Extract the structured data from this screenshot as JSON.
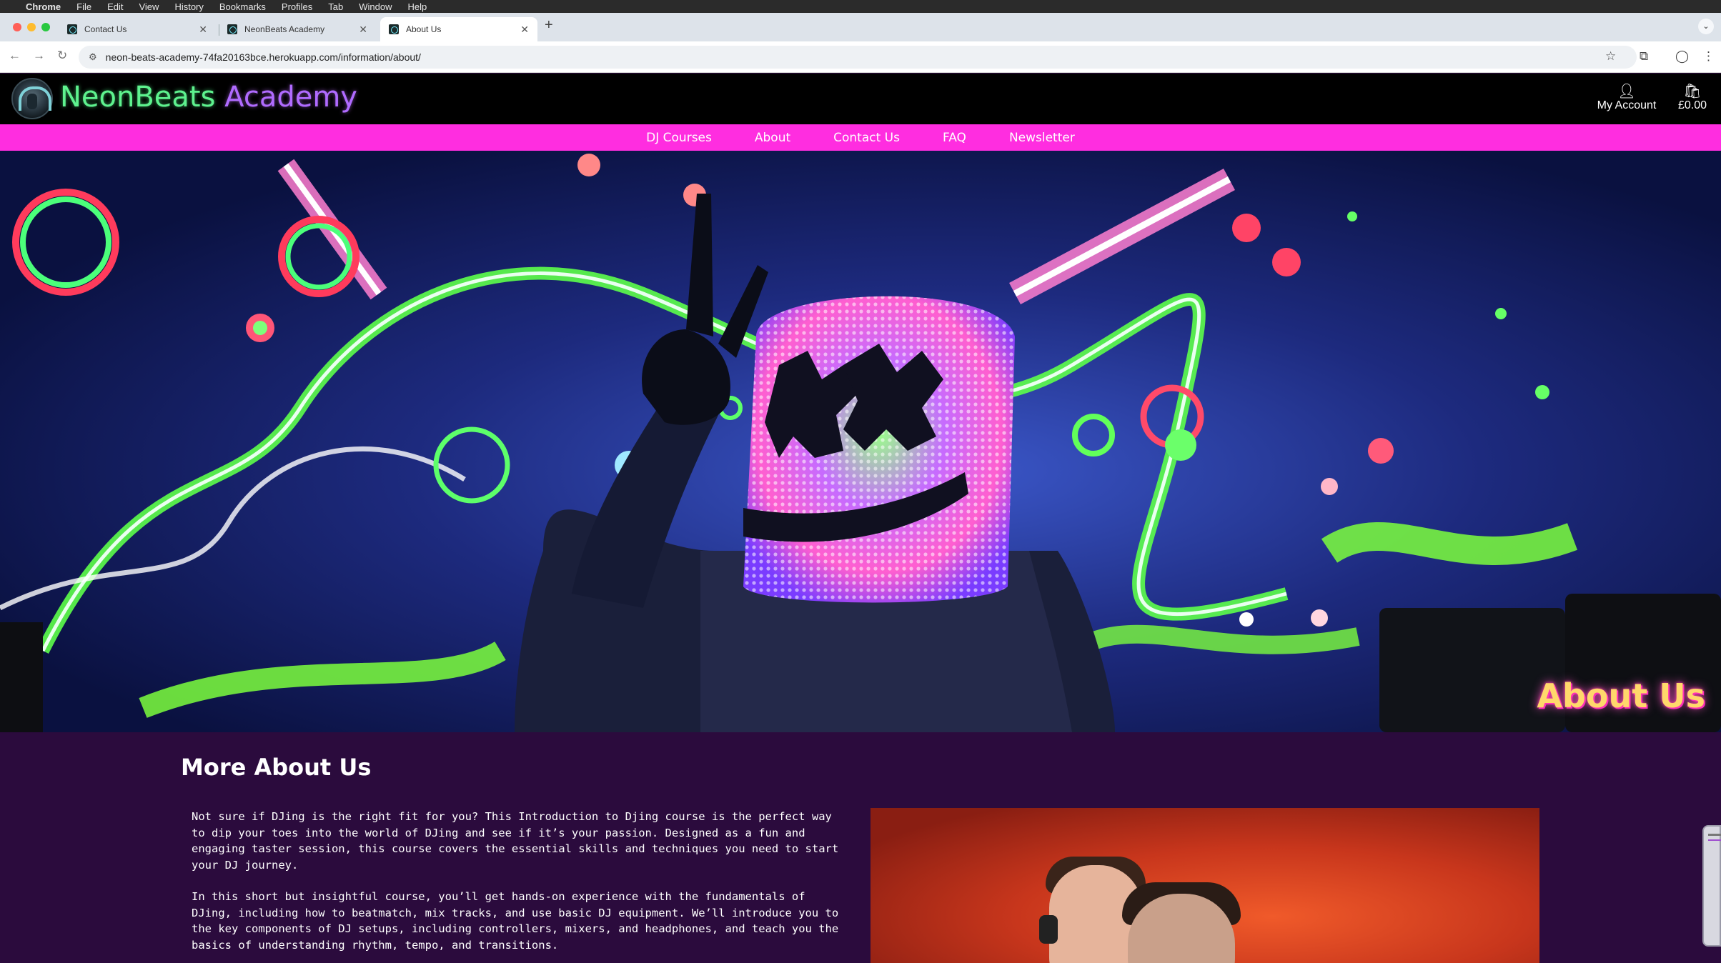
{
  "macos_menu": {
    "app": "Chrome",
    "items": [
      "File",
      "Edit",
      "View",
      "History",
      "Bookmarks",
      "Profiles",
      "Tab",
      "Window",
      "Help"
    ]
  },
  "browser": {
    "tabs": [
      {
        "title": "Contact Us",
        "active": false
      },
      {
        "title": "NeonBeats Academy",
        "active": false
      },
      {
        "title": "About Us",
        "active": true
      }
    ],
    "url": "neon-beats-academy-74fa20163bce.herokuapp.com/information/about/"
  },
  "site": {
    "brand_part1": "NeonBeats",
    "brand_part2": "Academy",
    "account_label": "My Account",
    "cart_total": "£0.00",
    "nav": [
      "DJ Courses",
      "About",
      "Contact Us",
      "FAQ",
      "Newsletter"
    ],
    "hero_title": "About Us",
    "section_title": "More About Us",
    "paragraph1": "Not sure if DJing is the right fit for you? This Introduction to Djing course is the perfect way to dip your toes into the world of DJing and see if it’s your passion. Designed as a fun and engaging taster session, this course covers the essential skills and techniques you need to start your DJ journey.",
    "paragraph2": "In this short but insightful course, you’ll get hands-on experience with the fundamentals of DJing, including how to beatmatch, mix tracks, and use basic DJ equipment. We’ll introduce you to the key components of DJ setups, including controllers, mixers, and headphones, and teach you the basics of understanding rhythm, tempo, and transitions."
  },
  "colors": {
    "nav_bg": "#ff2de0",
    "brand_green": "#5ef28e",
    "brand_purple": "#b06bff",
    "content_bg": "#2b0b3d"
  },
  "icons": {
    "account": "user-icon",
    "cart": "shopping-bag-icon",
    "back": "arrow-left-icon",
    "forward": "arrow-right-icon",
    "reload": "reload-icon",
    "bookmark": "star-icon",
    "extensions": "puzzle-icon",
    "profile": "profile-icon",
    "menu": "kebab-menu-icon"
  }
}
